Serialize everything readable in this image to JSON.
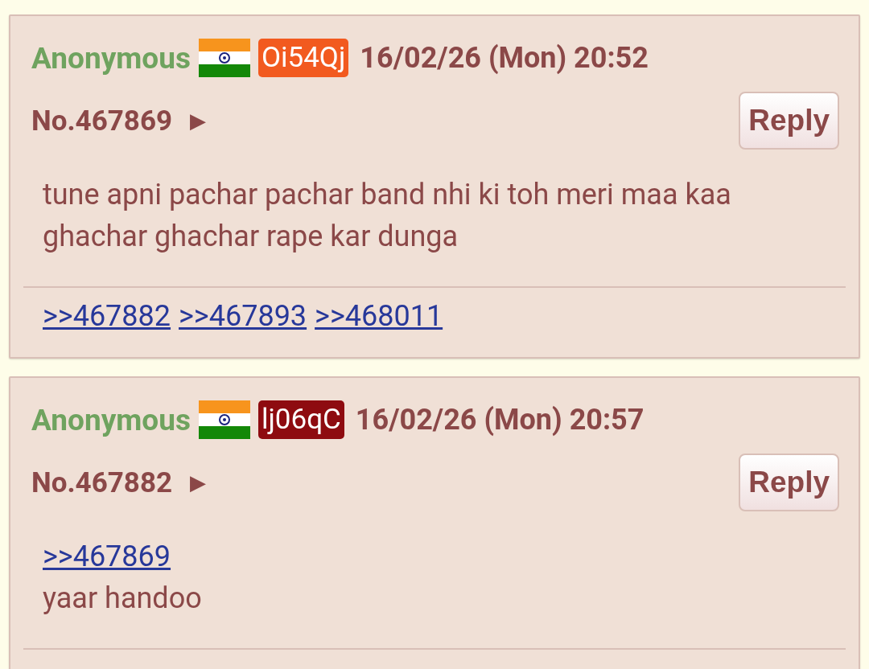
{
  "posts": [
    {
      "name": "Anonymous",
      "id_badge": {
        "text": "Oi54Qj",
        "color": "#f25a1f"
      },
      "date": "16/02/26 (Mon) 20:52",
      "number": "No.467869",
      "arrow": "▶",
      "reply_button": "Reply",
      "body": [
        {
          "kind": "text",
          "text": "tune apni pachar pachar band nhi ki toh meri maa kaa ghachar ghachar rape kar dunga"
        }
      ],
      "backlinks": [
        ">>467882",
        ">>467893",
        ">>468011"
      ]
    },
    {
      "name": "Anonymous",
      "id_badge": {
        "text": "lj06qC",
        "color": "#8e0b10"
      },
      "date": "16/02/26 (Mon) 20:57",
      "number": "No.467882",
      "arrow": "▶",
      "reply_button": "Reply",
      "body": [
        {
          "kind": "quote",
          "text": ">>467869"
        },
        {
          "kind": "text",
          "text": "yaar handoo"
        }
      ]
    }
  ]
}
